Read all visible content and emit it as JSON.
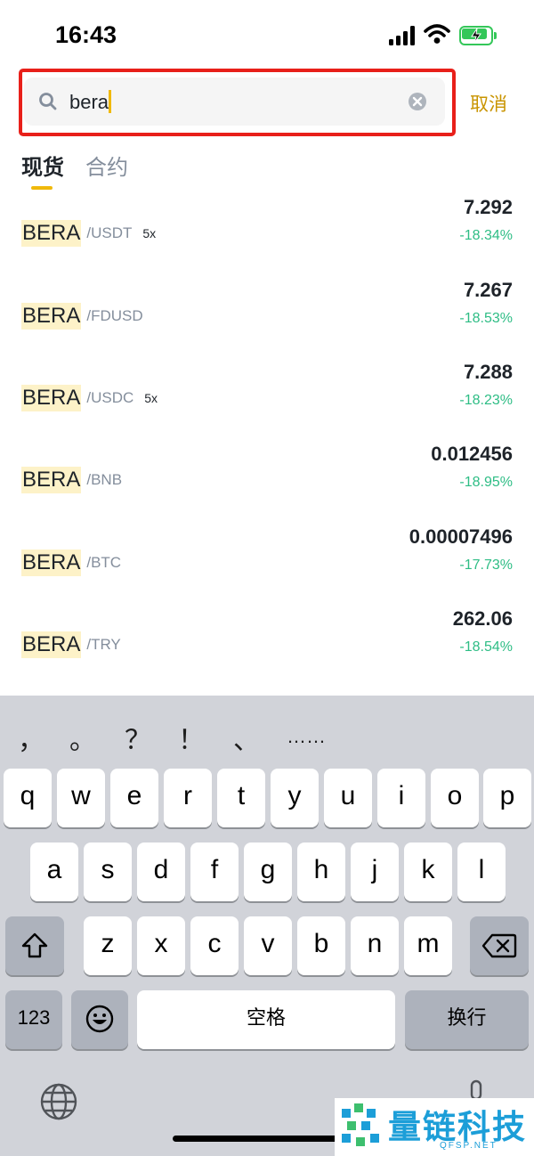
{
  "status_bar": {
    "time": "16:43"
  },
  "search": {
    "value": "bera",
    "cancel_label": "取消"
  },
  "tabs": [
    {
      "label": "现货",
      "active": true
    },
    {
      "label": "合约",
      "active": false
    }
  ],
  "results": [
    {
      "base": "BERA",
      "quote": "/USDT",
      "leverage": "5x",
      "price": "7.292",
      "change": "-18.34%"
    },
    {
      "base": "BERA",
      "quote": "/FDUSD",
      "leverage": "",
      "price": "7.267",
      "change": "-18.53%"
    },
    {
      "base": "BERA",
      "quote": "/USDC",
      "leverage": "5x",
      "price": "7.288",
      "change": "-18.23%"
    },
    {
      "base": "BERA",
      "quote": "/BNB",
      "leverage": "",
      "price": "0.012456",
      "change": "-18.95%"
    },
    {
      "base": "BERA",
      "quote": "/BTC",
      "leverage": "",
      "price": "0.00007496",
      "change": "-17.73%"
    },
    {
      "base": "BERA",
      "quote": "/TRY",
      "leverage": "",
      "price": "262.06",
      "change": "-18.54%"
    }
  ],
  "keyboard": {
    "suggestions": [
      "，",
      "。",
      "？",
      "！",
      "、",
      "……"
    ],
    "row1": [
      "q",
      "w",
      "e",
      "r",
      "t",
      "y",
      "u",
      "i",
      "o",
      "p"
    ],
    "row2": [
      "a",
      "s",
      "d",
      "f",
      "g",
      "h",
      "j",
      "k",
      "l"
    ],
    "row3": [
      "z",
      "x",
      "c",
      "v",
      "b",
      "n",
      "m"
    ],
    "numbers_label": "123",
    "space_label": "空格",
    "return_label": "换行"
  },
  "watermark": {
    "title": "量链科技",
    "subtitle": "QFSP.NET"
  },
  "colors": {
    "accent": "#f0b90b",
    "negative_change": "#2ebd85",
    "highlight": "#e8201a"
  }
}
